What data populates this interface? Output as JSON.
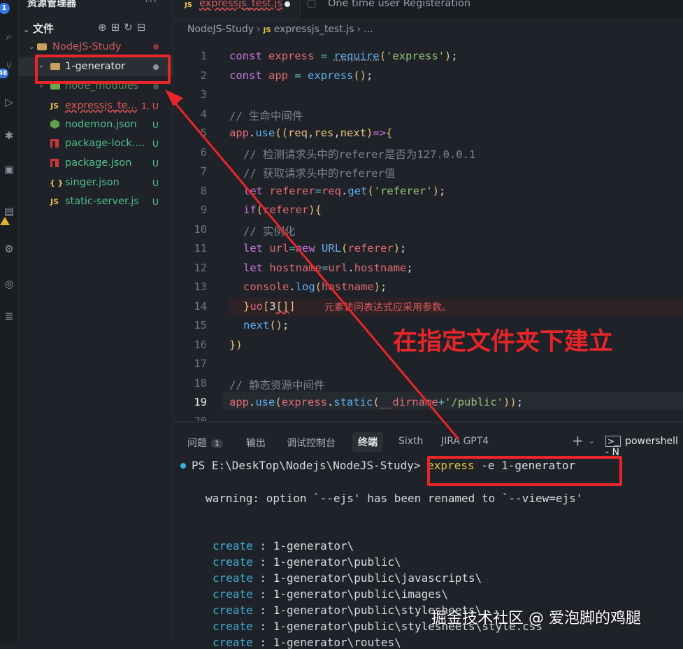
{
  "activity_bar": {
    "badge_top": "1",
    "badge_scm": "48"
  },
  "sidebar": {
    "title": "资源管理器",
    "more": "···",
    "section": "文件",
    "root_folder": "NodeJS-Study",
    "items": [
      {
        "label": "1-generator",
        "status": "",
        "kind": "folder"
      },
      {
        "label": "node_modules",
        "status": "",
        "kind": "folder"
      },
      {
        "label": "expressjs_te...",
        "status": "1, U",
        "kind": "js"
      },
      {
        "label": "nodemon.json",
        "status": "U",
        "kind": "node"
      },
      {
        "label": "package-lock....",
        "status": "U",
        "kind": "npm"
      },
      {
        "label": "package.json",
        "status": "U",
        "kind": "npm"
      },
      {
        "label": "singer.json",
        "status": "U",
        "kind": "json"
      },
      {
        "label": "static-server.js",
        "status": "U",
        "kind": "js"
      }
    ]
  },
  "tabs": [
    {
      "label": "expressjs_test.js",
      "active": true,
      "icon": "JS"
    },
    {
      "label": "One time user Registeration",
      "active": false
    }
  ],
  "breadcrumb": [
    "NodeJS-Study",
    "expressjs_test.js",
    "..."
  ],
  "editor": {
    "line_numbers": [
      "1",
      "2",
      "3",
      "4",
      "5",
      "6",
      "7",
      "8",
      "9",
      "10",
      "11",
      "12",
      "13",
      "14",
      "15",
      "16",
      "17",
      "18",
      "19",
      "20"
    ],
    "current_line": "19",
    "error_message": "元素访问表达式应采用参数。"
  },
  "panel": {
    "tabs": [
      "问题",
      "输出",
      "调试控制台",
      "终端",
      "Sixth",
      "JIRA GPT4"
    ],
    "problems_count": "1",
    "active_tab": "终端",
    "add_icon": "+",
    "shell": "powershell - N",
    "prompt": "PS E:\\DeskTop\\Nodejs\\NodeJS-Study>",
    "command": "express",
    "command_args": " -e 1-generator",
    "warning": "warning: option `--ejs' has been renamed to `--view=ejs'",
    "create_label": "create",
    "create_lines": [
      " : 1-generator\\",
      " : 1-generator\\public\\",
      " : 1-generator\\public\\javascripts\\",
      " : 1-generator\\public\\images\\",
      " : 1-generator\\public\\stylesheets\\",
      " : 1-generator\\public\\stylesheets\\style.css",
      " : 1-generator\\routes\\"
    ]
  },
  "annotation": "在指定文件夹下建立",
  "watermark": "掘金技术社区 @ 爱泡脚的鸡腿",
  "colors": {
    "annotation_red": "#e8262a",
    "terminal_create": "#3fb0d8",
    "accent_blue": "#3578e5"
  }
}
